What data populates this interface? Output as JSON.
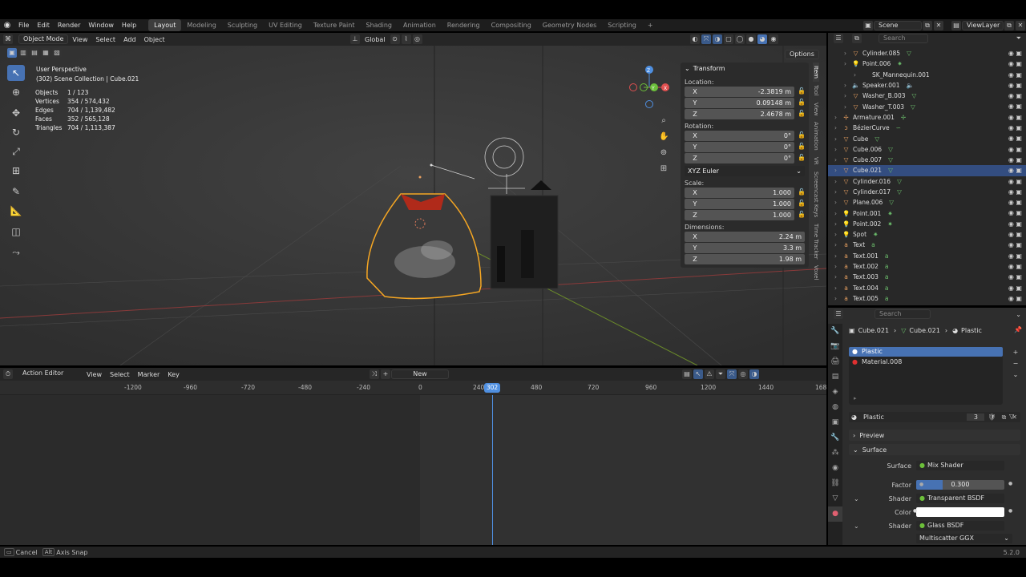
{
  "menu": [
    "File",
    "Edit",
    "Render",
    "Window",
    "Help"
  ],
  "workspaces": [
    "Layout",
    "Modeling",
    "Sculpting",
    "UV Editing",
    "Texture Paint",
    "Shading",
    "Animation",
    "Rendering",
    "Compositing",
    "Geometry Nodes",
    "Scripting"
  ],
  "add_tab": "+",
  "scene": "Scene",
  "view_layer": "ViewLayer",
  "viewport": {
    "mode": "Object Mode",
    "menus": [
      "View",
      "Select",
      "Add",
      "Object"
    ],
    "orientation": "Global",
    "options": "Options",
    "info_line1": "User Perspective",
    "info_line2": "(302) Scene Collection | Cube.021",
    "stats": [
      {
        "label": "Objects",
        "value": "1 / 123"
      },
      {
        "label": "Vertices",
        "value": "354 / 574,432"
      },
      {
        "label": "Edges",
        "value": "704 / 1,139,482"
      },
      {
        "label": "Faces",
        "value": "352 / 565,128"
      },
      {
        "label": "Triangles",
        "value": "704 / 1,113,387"
      }
    ],
    "gizmo": {
      "x": "X",
      "y": "Y",
      "z": "Z"
    }
  },
  "transform": {
    "header": "Transform",
    "location_label": "Location:",
    "location": [
      {
        "axis": "X",
        "value": "-2.3819 m"
      },
      {
        "axis": "Y",
        "value": "0.09148 m"
      },
      {
        "axis": "Z",
        "value": "2.4678 m"
      }
    ],
    "rotation_label": "Rotation:",
    "rotation": [
      {
        "axis": "X",
        "value": "0°"
      },
      {
        "axis": "Y",
        "value": "0°"
      },
      {
        "axis": "Z",
        "value": "0°"
      }
    ],
    "rotation_mode": "XYZ Euler",
    "scale_label": "Scale:",
    "scale": [
      {
        "axis": "X",
        "value": "1.000"
      },
      {
        "axis": "Y",
        "value": "1.000"
      },
      {
        "axis": "Z",
        "value": "1.000"
      }
    ],
    "dimensions_label": "Dimensions:",
    "dimensions": [
      {
        "axis": "X",
        "value": "2.24 m"
      },
      {
        "axis": "Y",
        "value": "3.3 m"
      },
      {
        "axis": "Z",
        "value": "1.98 m"
      }
    ]
  },
  "side_tabs": [
    "Item",
    "Tool",
    "View",
    "Animation",
    "VR",
    "Screencast Keys",
    "Time Tracker",
    "Voxel"
  ],
  "action_editor": {
    "editor": "Action Editor",
    "menus": [
      "View",
      "Select",
      "Marker",
      "Key"
    ],
    "new_label": "New",
    "ticks": [
      "-1200",
      "-960",
      "-720",
      "-480",
      "-240",
      "0",
      "240",
      "480",
      "720",
      "960",
      "1200",
      "1440",
      "168"
    ],
    "current_frame": "302"
  },
  "outliner": {
    "search_placeholder": "Search",
    "rows": [
      {
        "name": "Cylinder.085",
        "icon": "mesh-icon",
        "indent": 1
      },
      {
        "name": "Point.006",
        "icon": "light-icon",
        "indent": 1
      },
      {
        "name": "SK_Mannequin.001",
        "icon": "",
        "indent": 2
      },
      {
        "name": "Speaker.001",
        "icon": "speaker-icon",
        "indent": 1
      },
      {
        "name": "Washer_B.003",
        "icon": "mesh-icon",
        "indent": 1
      },
      {
        "name": "Washer_T.003",
        "icon": "mesh-icon",
        "indent": 1
      },
      {
        "name": "Armature.001",
        "icon": "armature-icon",
        "indent": 0
      },
      {
        "name": "BézierCurve",
        "icon": "curve-icon",
        "indent": 0
      },
      {
        "name": "Cube",
        "icon": "mesh-icon",
        "indent": 0
      },
      {
        "name": "Cube.006",
        "icon": "mesh-icon",
        "indent": 0
      },
      {
        "name": "Cube.007",
        "icon": "mesh-icon",
        "indent": 0
      },
      {
        "name": "Cube.021",
        "icon": "mesh-icon",
        "indent": 0,
        "selected": true
      },
      {
        "name": "Cylinder.016",
        "icon": "mesh-icon",
        "indent": 0
      },
      {
        "name": "Cylinder.017",
        "icon": "mesh-icon",
        "indent": 0
      },
      {
        "name": "Plane.006",
        "icon": "mesh-icon",
        "indent": 0
      },
      {
        "name": "Point.001",
        "icon": "light-icon",
        "indent": 0
      },
      {
        "name": "Point.002",
        "icon": "light-icon",
        "indent": 0
      },
      {
        "name": "Spot",
        "icon": "light-icon",
        "indent": 0
      },
      {
        "name": "Text",
        "icon": "text-icon",
        "indent": 0
      },
      {
        "name": "Text.001",
        "icon": "text-icon",
        "indent": 0
      },
      {
        "name": "Text.002",
        "icon": "text-icon",
        "indent": 0
      },
      {
        "name": "Text.003",
        "icon": "text-icon",
        "indent": 0
      },
      {
        "name": "Text.004",
        "icon": "text-icon",
        "indent": 0
      },
      {
        "name": "Text.005",
        "icon": "text-icon",
        "indent": 0
      }
    ]
  },
  "properties": {
    "search_placeholder": "Search",
    "breadcrumb": [
      "Cube.021",
      "Cube.021",
      "Plastic"
    ],
    "slots": [
      "Plastic",
      "Material.008"
    ],
    "material_name": "Plastic",
    "users": "3",
    "preview": "Preview",
    "surface": "Surface",
    "surface_label": "Surface",
    "surface_value": "Mix Shader",
    "factor_label": "Factor",
    "factor_value": "0.300",
    "factor_fraction": 0.3,
    "shader_label": "Shader",
    "shader1": "Transparent BSDF",
    "color_label": "Color",
    "shader2_label": "Shader",
    "shader2": "Glass BSDF",
    "distribution": "Multiscatter GGX"
  },
  "status": {
    "cancel_key": "Cancel",
    "alt_key": "Alt",
    "axis_snap": "Axis Snap",
    "version": "5.2.0"
  },
  "colors": {
    "accent": "#4772b3",
    "selection": "#f5a623",
    "playhead": "#4f8fe0"
  }
}
